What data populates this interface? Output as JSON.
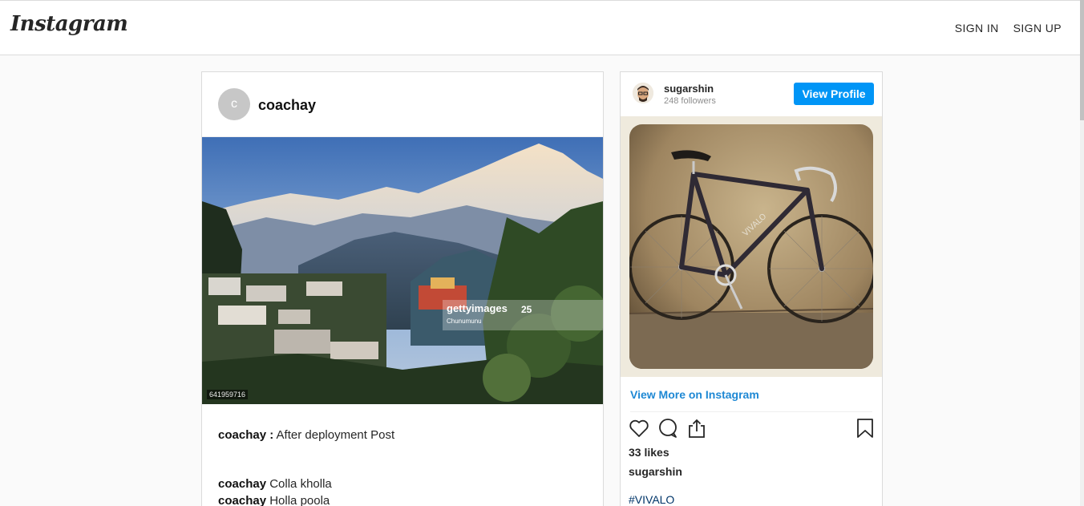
{
  "app": {
    "logo_text": "Instagram"
  },
  "nav": {
    "sign_in": "SIGN IN",
    "sign_up": "SIGN UP"
  },
  "post": {
    "avatar_letter": "c",
    "username": "coachay",
    "image_id_label": "641959716",
    "watermark": {
      "brand": "gettyimages",
      "credit": "Chunumunu",
      "badge": "25"
    },
    "caption": {
      "author": "coachay :",
      "text": "After deployment Post"
    },
    "comments": [
      {
        "author": "coachay",
        "text": "Colla kholla"
      },
      {
        "author": "coachay",
        "text": "Holla poola"
      }
    ]
  },
  "embed": {
    "username": "sugarshin",
    "followers": "248 followers",
    "view_profile_label": "View Profile",
    "view_more_label": "View More on Instagram",
    "likes": "33 likes",
    "owner": "sugarshin",
    "hashtag": "#VIVALO",
    "icons": [
      "heart-icon",
      "comment-icon",
      "share-icon",
      "bookmark-icon"
    ]
  },
  "colors": {
    "accent_blue": "#0095f6",
    "link_blue": "#1e88d4",
    "border": "#dbdbdb",
    "background": "#fafafa"
  }
}
